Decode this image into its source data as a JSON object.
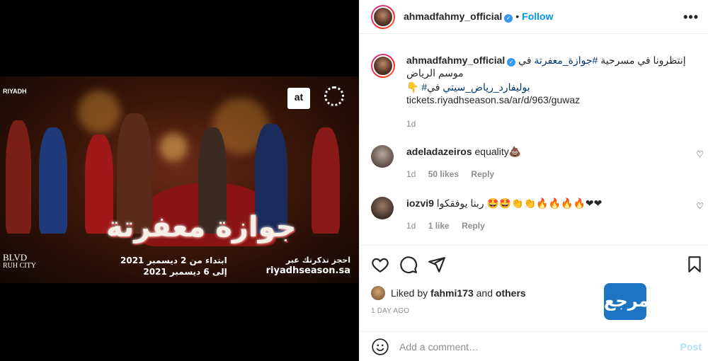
{
  "media": {
    "poster_title": "جوازة معفرتة",
    "dates_line1": "ابتداء من 2 ديسمبر 2021",
    "dates_line2": "إلى 6 ديسمبر 2021",
    "book_line": "احجز تذكرتك عبر",
    "site": "riyadhseason.sa",
    "riyadh_label": "RIYADH",
    "blvd_label1": "BLVD",
    "blvd_label2": "RUH CITY",
    "at_logo": "at"
  },
  "header": {
    "username": "ahmadfahmy_official",
    "follow_label": "Follow",
    "more_label": "•••"
  },
  "caption": {
    "username": "ahmadfahmy_official",
    "line1": "إنتظرونا في مسرحية",
    "hashtag1": "#جوازة_معفرتة",
    "line1b": "في موسم الرياض",
    "line2_prefix": "👇",
    "hashtag2": "#بوليفارد_رياض_سيتي",
    "line2_suffix": "في",
    "link": "tickets.riyadhseason.sa/ar/d/963/guwaz",
    "time": "1d"
  },
  "comments": [
    {
      "username": "adeladazeiros",
      "text": "equality💩",
      "time": "1d",
      "likes": "50 likes",
      "reply": "Reply"
    },
    {
      "username": "iozvi9",
      "text": "ربنا يوفقكوا 🤩🤩👏👏🔥🔥🔥🔥❤❤",
      "time": "1d",
      "likes": "1 like",
      "reply": "Reply"
    }
  ],
  "actions": {
    "liked_prefix": "Liked by",
    "liked_user": "fahmi173",
    "liked_and": "and",
    "liked_others": "others",
    "posted_ago": "1 DAY AGO"
  },
  "watermark": "المرجع",
  "add_comment": {
    "placeholder": "Add a comment…",
    "post_label": "Post"
  }
}
